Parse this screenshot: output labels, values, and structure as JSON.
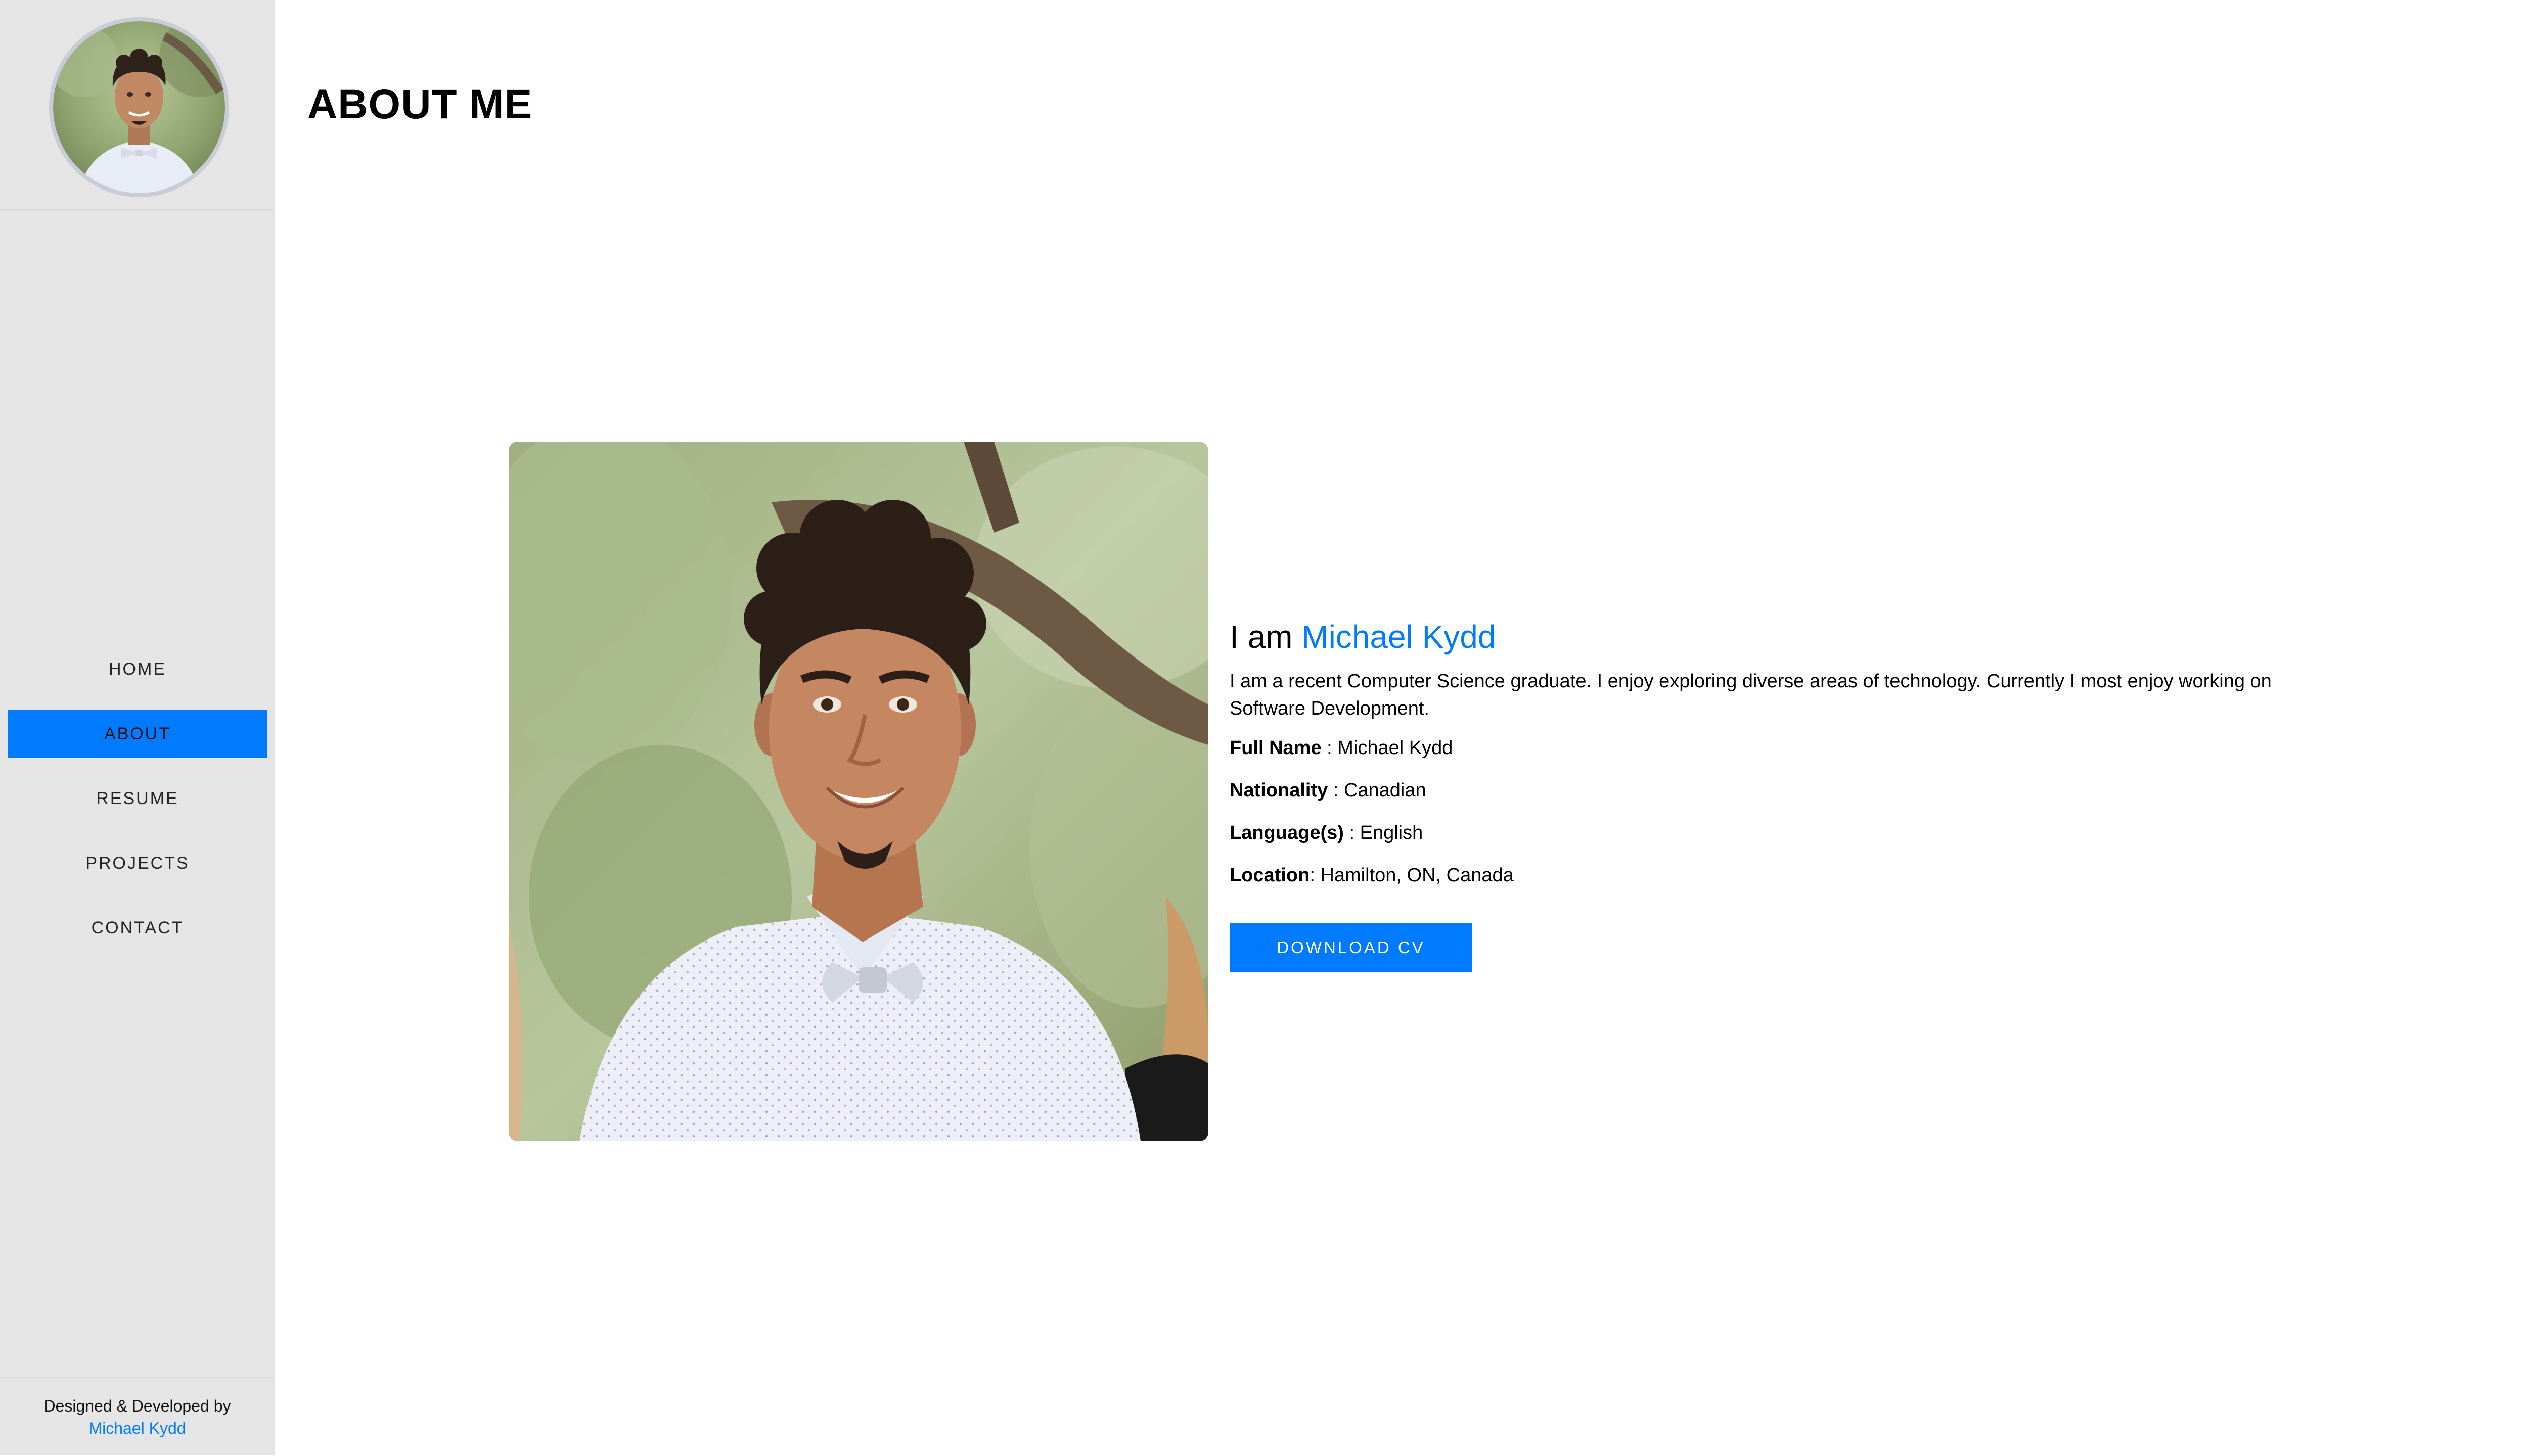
{
  "sidebar": {
    "nav": [
      {
        "label": "HOME",
        "active": false
      },
      {
        "label": "ABOUT",
        "active": true
      },
      {
        "label": "RESUME",
        "active": false
      },
      {
        "label": "PROJECTS",
        "active": false
      },
      {
        "label": "CONTACT",
        "active": false
      }
    ],
    "footer": {
      "line1": "Designed & Developed by",
      "author": "Michael Kydd"
    }
  },
  "main": {
    "title": "ABOUT ME",
    "intro": {
      "prefix": "I am",
      "name": "Michael Kydd",
      "text": "I am a recent Computer Science graduate. I enjoy exploring diverse areas of technology. Currently I most enjoy working on Software Development."
    },
    "fields": {
      "full_name": {
        "label": "Full Name",
        "sep": " : ",
        "value": "Michael Kydd"
      },
      "nationality": {
        "label": "Nationality",
        "sep": " : ",
        "value": "Canadian"
      },
      "languages": {
        "label": "Language(s)",
        "sep": " : ",
        "value": "English"
      },
      "location": {
        "label": "Location",
        "sep": ": ",
        "value": "Hamilton, ON, Canada"
      }
    },
    "download_button": "DOWNLOAD CV"
  },
  "colors": {
    "accent": "#007bff",
    "sidebar_bg": "#e5e5e5",
    "avatar_border": "#c9cbd6"
  }
}
